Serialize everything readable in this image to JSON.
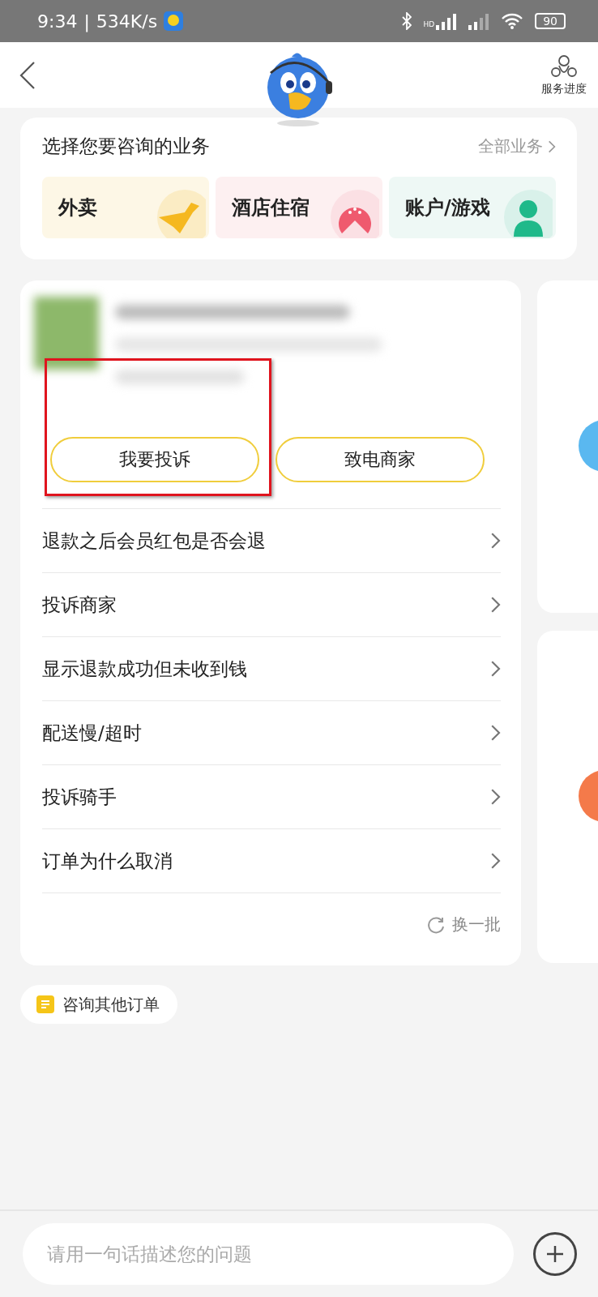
{
  "status_bar": {
    "time": "9:34",
    "separator": "|",
    "speed": "534K/s",
    "signal_label": "HD",
    "battery": "90"
  },
  "header": {
    "progress_label": "服务进度"
  },
  "business": {
    "title": "选择您要咨询的业务",
    "all_link": "全部业务",
    "tiles": [
      {
        "label": "外卖",
        "kind": "delivery",
        "color": "#fdf7e6"
      },
      {
        "label": "酒店住宿",
        "kind": "hotel",
        "color": "#fdf0f1"
      },
      {
        "label": "账户/游戏",
        "kind": "account",
        "color": "#eef8f5"
      }
    ]
  },
  "order": {
    "buttons": [
      {
        "label": "我要投诉",
        "highlighted": true
      },
      {
        "label": "致电商家",
        "highlighted": false
      }
    ],
    "questions": [
      "退款之后会员红包是否会退",
      "投诉商家",
      "显示退款成功但未收到钱",
      "配送慢/超时",
      "投诉骑手",
      "订单为什么取消"
    ],
    "refresh": "换一批"
  },
  "side_cards": [
    {
      "color": "#5ab8f0"
    },
    {
      "color": "#f47a4a"
    }
  ],
  "other_orders": "咨询其他订单",
  "composer": {
    "placeholder": "请用一句话描述您的问题"
  }
}
